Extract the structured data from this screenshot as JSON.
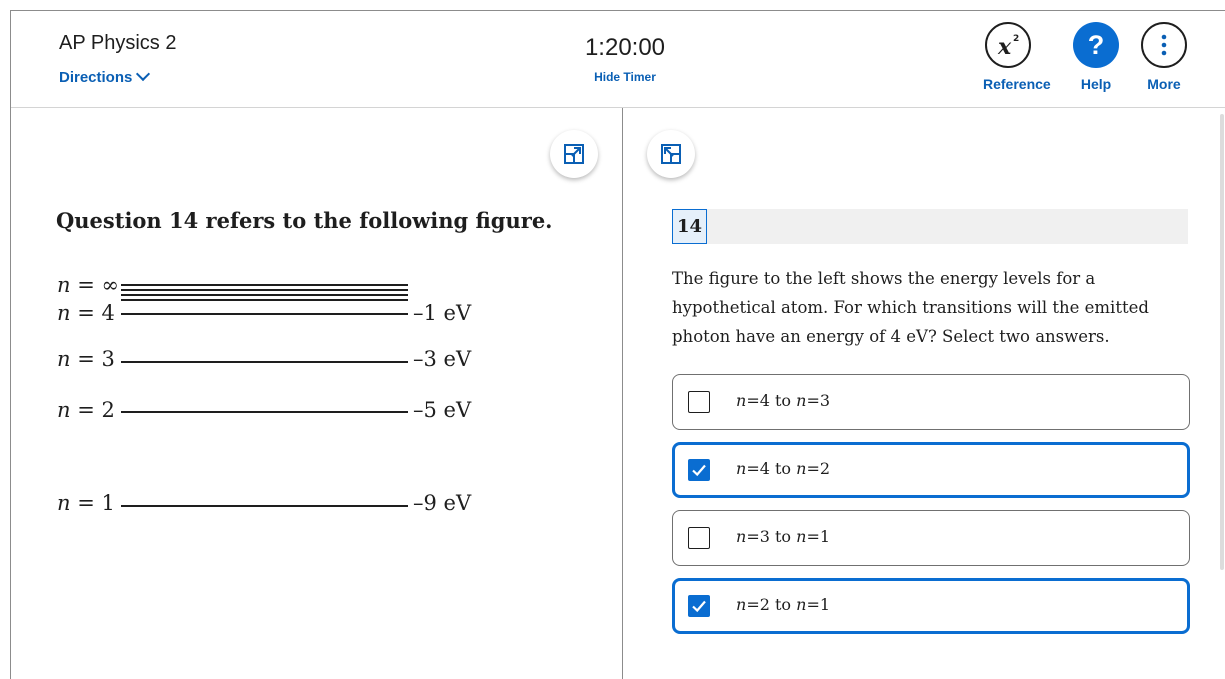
{
  "header": {
    "course_title": "AP Physics 2",
    "directions_label": "Directions",
    "timer": "1:20:00",
    "hide_timer_label": "Hide Timer",
    "tools": {
      "reference_label": "Reference",
      "help_label": "Help",
      "help_glyph": "?",
      "more_label": "More"
    }
  },
  "stimulus": {
    "heading": "Question 14 refers to the following figure.",
    "levels": [
      {
        "n": "∞",
        "energy": ""
      },
      {
        "n": "4",
        "energy": "–1 eV"
      },
      {
        "n": "3",
        "energy": "–3 eV"
      },
      {
        "n": "2",
        "energy": "–5 eV"
      },
      {
        "n": "1",
        "energy": "–9 eV"
      }
    ]
  },
  "question": {
    "number": "14",
    "text": "The figure to the left shows the energy levels for a hypothetical atom. For which transitions will the emitted photon have an energy of 4 eV? Select two answers.",
    "options": [
      {
        "from": "4",
        "to": "3",
        "selected": false
      },
      {
        "from": "4",
        "to": "2",
        "selected": true
      },
      {
        "from": "3",
        "to": "1",
        "selected": false
      },
      {
        "from": "2",
        "to": "1",
        "selected": true
      }
    ]
  },
  "colors": {
    "accent": "#0a6dd1",
    "link": "#0a5fb4",
    "text": "#1e1e1e"
  }
}
